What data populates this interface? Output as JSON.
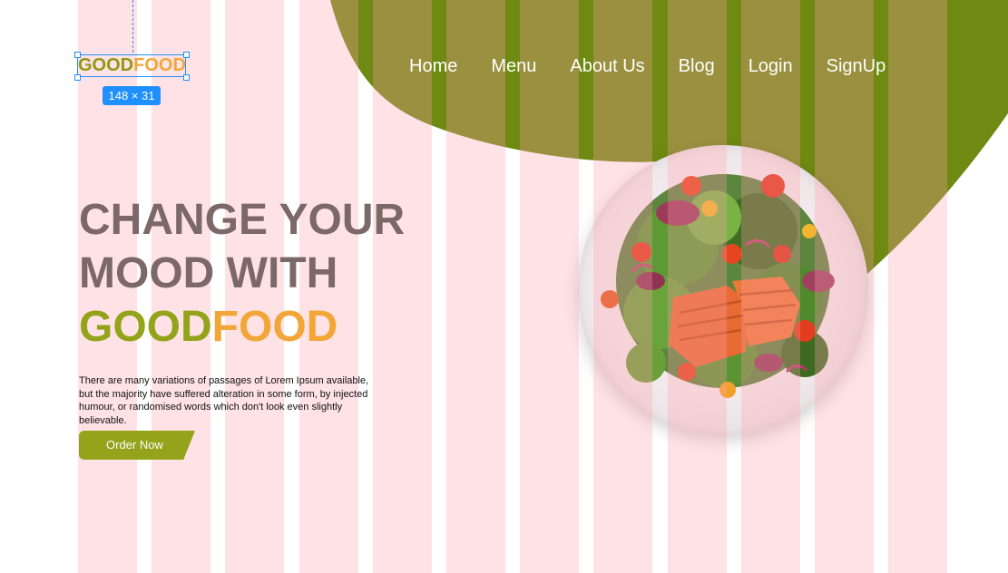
{
  "logo": {
    "part1": "GOOD",
    "part2": "FOOD"
  },
  "selection": {
    "size_label": "148 × 31"
  },
  "nav": {
    "items": [
      {
        "label": "Home"
      },
      {
        "label": "Menu"
      },
      {
        "label": "About Us"
      },
      {
        "label": "Blog"
      },
      {
        "label": "Login"
      },
      {
        "label": "SignUp"
      }
    ]
  },
  "hero": {
    "line1": "CHANGE YOUR",
    "line2": "MOOD WITH",
    "brand_part1": "GOOD",
    "brand_part2": "FOOD",
    "description": "There are many variations of passages of Lorem Ipsum available, but the majority have suffered alteration in some form, by injected humour, or randomised words which don't look even slightly believable.",
    "cta_label": "Order Now"
  },
  "image": {
    "subject": "salmon salad plate"
  },
  "colors": {
    "brand_green": "#93a31a",
    "brand_orange": "#f2a637",
    "hero_text": "#7c6868",
    "blob_green": "#6f8a12",
    "grid_overlay": "#ffa0aa",
    "selection_blue": "#1e90ff"
  }
}
